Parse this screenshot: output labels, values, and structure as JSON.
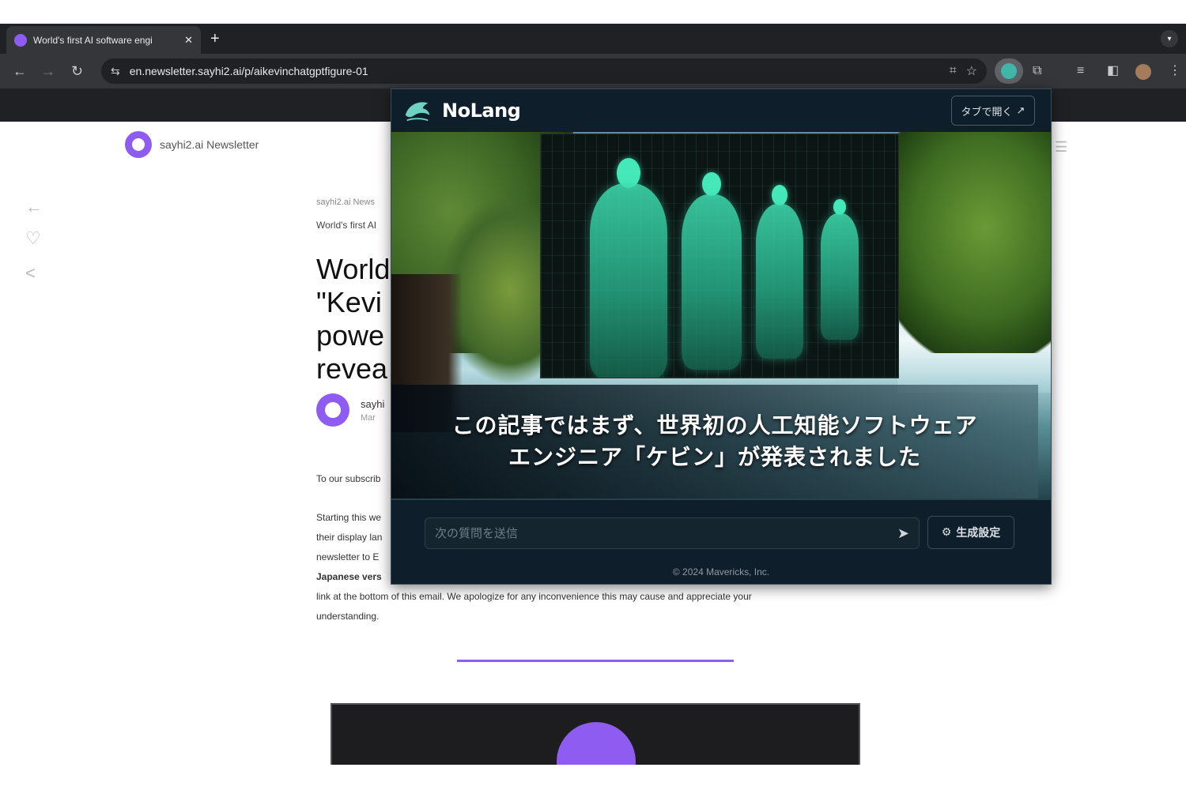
{
  "browser": {
    "tab_title": "World's first AI software engi",
    "tab_close": "✕",
    "new_tab": "+",
    "url": "en.newsletter.sayhi2.ai/p/aikevinchatgptfigure-01"
  },
  "page": {
    "brand_name": "sayhi2.ai Newsletter",
    "crumb": "sayhi2.ai News",
    "subtitle": "World's first AI",
    "headline_lines": [
      "World",
      "\"Kevi",
      "powe",
      "revea"
    ],
    "author_name": "sayhi",
    "author_date": "Mar",
    "body": {
      "greeting": "To our subscrib",
      "p2_line1": "Starting this we",
      "p2_line2": "their display lan",
      "p2_line3": "newsletter to E",
      "p2_line4_bold": "Japanese vers",
      "p2_line5": "link at the bottom of this email. We apologize for any inconvenience this may cause and appreciate your",
      "p2_line6": "understanding."
    }
  },
  "nolang": {
    "app_name": "NoLang",
    "open_tab_label": "タブで開く",
    "open_tab_icon": "external-link-icon",
    "caption_line1": "この記事ではまず、世界初の人工知能ソフトウェア",
    "caption_line2": "エンジニア「ケビン」が発表されました",
    "input_placeholder": "次の質問を送信",
    "settings_label": "生成設定",
    "footer": "© 2024 Mavericks, Inc."
  },
  "colors": {
    "accent": "#8e5cf0",
    "nolang_bg": "#0f1e2b",
    "chrome_bg": "#202124"
  }
}
